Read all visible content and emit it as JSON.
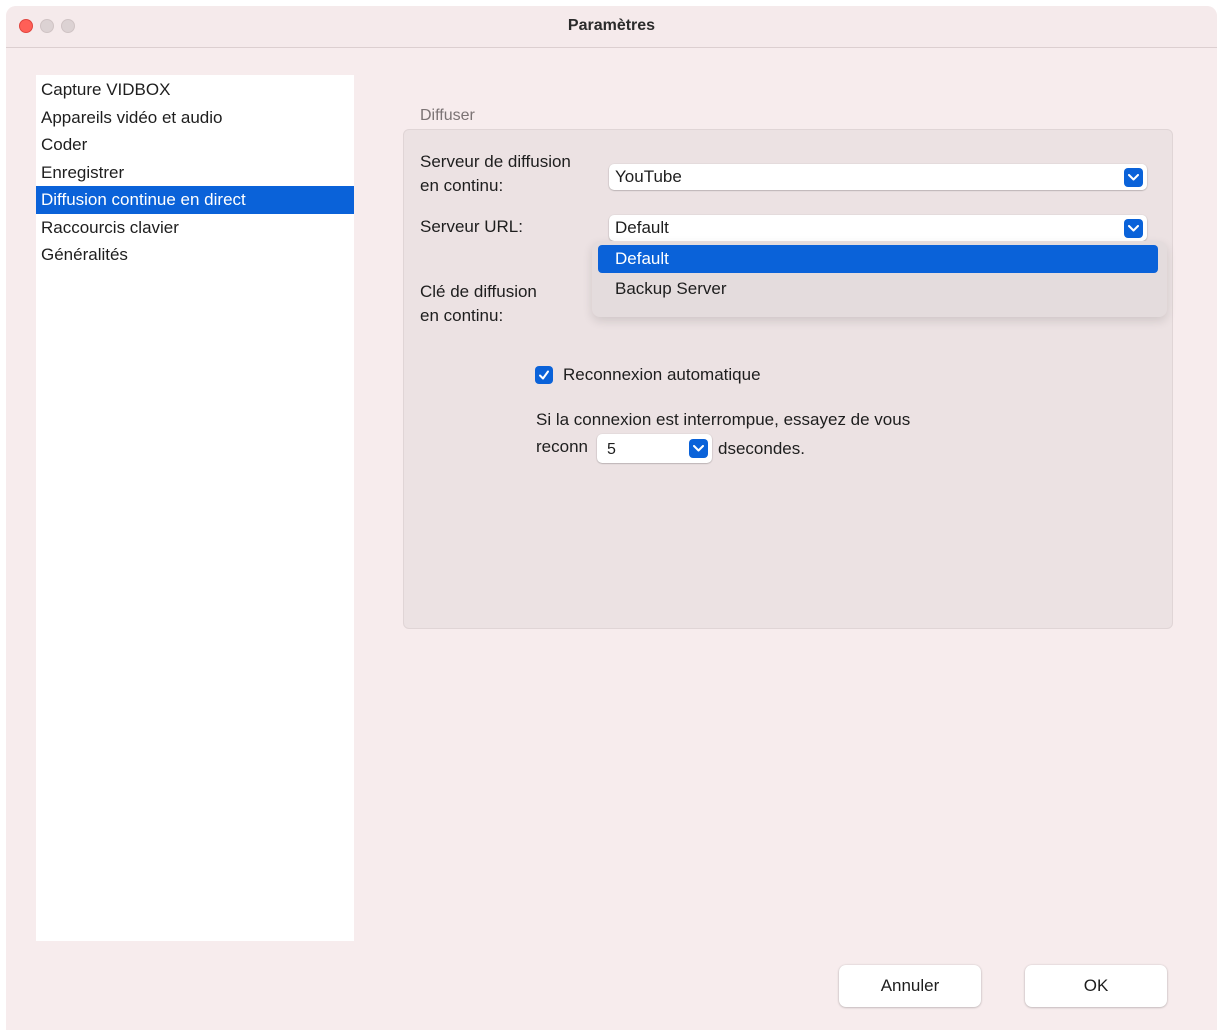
{
  "window": {
    "title": "Paramètres"
  },
  "sidebar": {
    "items": [
      {
        "label": "Capture VIDBOX"
      },
      {
        "label": "Appareils vidéo et audio"
      },
      {
        "label": "Coder"
      },
      {
        "label": "Enregistrer"
      },
      {
        "label": "Diffusion continue en direct"
      },
      {
        "label": "Raccourcis clavier"
      },
      {
        "label": "Généralités"
      }
    ],
    "selected_index": 4
  },
  "group": {
    "title": "Diffuser",
    "server_label_line1": "Serveur de diffusion",
    "server_label_line2": "en continu:",
    "server_value": "YouTube",
    "url_label": "Serveur URL:",
    "url_value": "Default",
    "url_options": [
      "Default",
      "Backup Server"
    ],
    "url_highlighted": "Default",
    "key_label_line1": "Clé de diffusion",
    "key_label_line2": "en continu:",
    "auto_reconnect_label": "Reconnexion automatique",
    "auto_reconnect_checked": true,
    "reconnect_text_line1": "Si la connexion est interrompue, essayez de vous",
    "reconnect_text_prefix": "reconn",
    "reconnect_seconds": "5",
    "reconnect_suffix": "dsecondes."
  },
  "footer": {
    "cancel_label": "Annuler",
    "ok_label": "OK"
  },
  "colors": {
    "accent": "#0a62d9",
    "window_bg": "#f7eced",
    "group_bg": "#ece2e3",
    "close_button": "#ff5f57"
  }
}
